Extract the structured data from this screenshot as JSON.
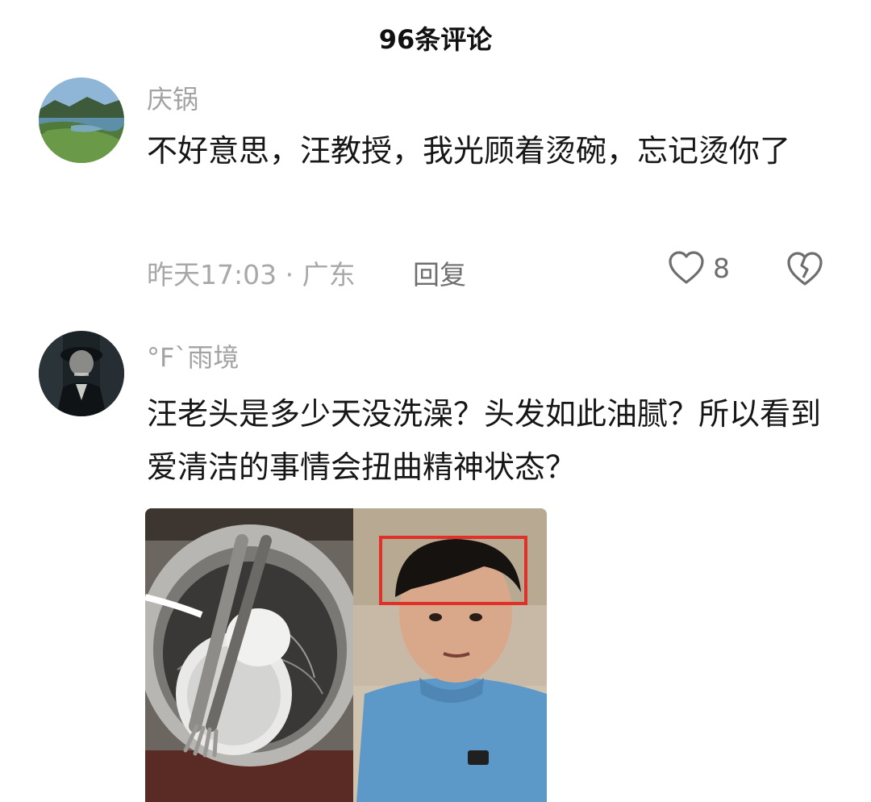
{
  "header": {
    "title": "96条评论"
  },
  "comments": [
    {
      "username": "庆锅",
      "text": "不好意思，汪教授，我光顾着烫碗，忘记烫你了",
      "time_location": "昨天17:03 · 广东",
      "reply_label": "回复",
      "likes": "8",
      "avatar_icon": "lake-landscape-avatar"
    },
    {
      "username": "°F`雨境",
      "text": "汪老头是多少天没洗澡？头发如此油腻？所以看到爱清洁的事情会扭曲精神状态？",
      "avatar_icon": "man-in-cap-avatar",
      "image_icon": "bowl-and-man-photo"
    }
  ],
  "colors": {
    "username": "#a3a3a3",
    "meta": "#a8a8a8",
    "action": "#6e6e6e",
    "highlight_box": "#e0302a"
  }
}
